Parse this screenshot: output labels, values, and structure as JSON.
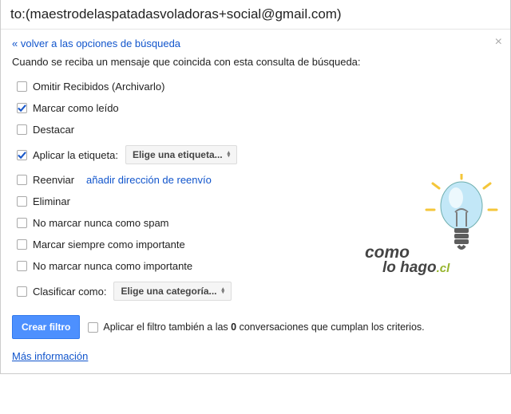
{
  "search_query": "to:(maestrodelaspatadasvoladoras+social@gmail.com)",
  "back_link": "« volver a las opciones de búsqueda",
  "intro_text": "Cuando se reciba un mensaje que coincida con esta consulta de búsqueda:",
  "options": {
    "skip_inbox": "Omitir Recibidos (Archivarlo)",
    "mark_read": "Marcar como leído",
    "star": "Destacar",
    "apply_label": "Aplicar la etiqueta:",
    "label_dropdown": "Elige una etiqueta...",
    "forward": "Reenviar",
    "forward_link": "añadir dirección de reenvío",
    "delete": "Eliminar",
    "never_spam": "No marcar nunca como spam",
    "always_important": "Marcar siempre como importante",
    "never_important": "No marcar nunca como importante",
    "categorize": "Clasificar como:",
    "category_dropdown": "Elige una categoría..."
  },
  "footer": {
    "create_btn": "Crear filtro",
    "also_apply_prefix": "Aplicar el filtro también a las ",
    "also_apply_count": "0",
    "also_apply_suffix": " conversaciones que cumplan los criterios."
  },
  "more_info": "Más información",
  "logo": {
    "line1": "como",
    "line2_a": "lo ",
    "line2_b": "hago",
    "tld": ".cl"
  }
}
